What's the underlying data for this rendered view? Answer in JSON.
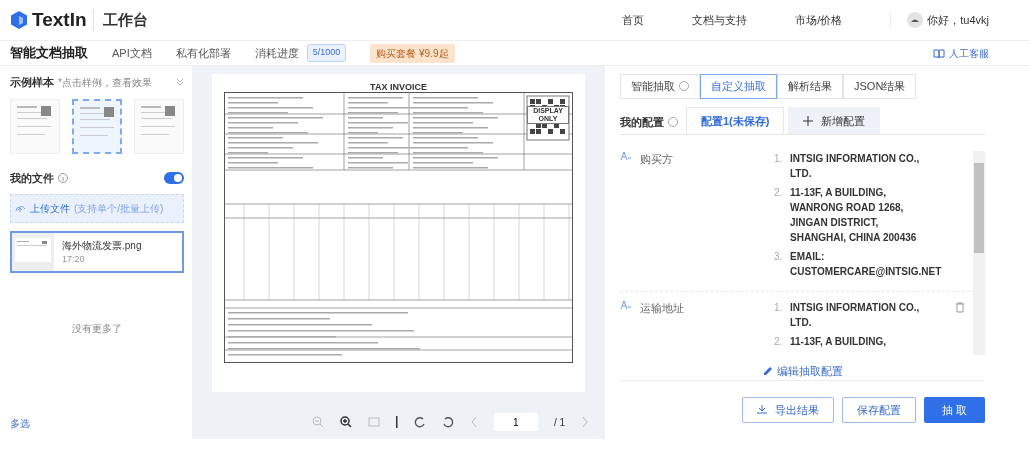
{
  "header": {
    "logo": "TextIn",
    "workspace": "工作台",
    "nav": [
      "首页",
      "文档与支持",
      "市场/价格"
    ],
    "user": "你好，tu4vkj"
  },
  "subnav": {
    "items": [
      {
        "label": "智能文档抽取",
        "selected": true
      },
      {
        "label": "API文档",
        "selected": false
      },
      {
        "label": "私有化部署",
        "selected": false
      }
    ],
    "usage_label": "消耗进度",
    "usage": "5/1000",
    "promo": "购买套餐 ¥9.9起",
    "support": "人工客服"
  },
  "samples": {
    "title": "示例样本",
    "hint": "*点击样例，查看效果",
    "thumbs": [
      {
        "selected": false
      },
      {
        "selected": true
      },
      {
        "selected": false
      }
    ]
  },
  "files": {
    "title": "我的文件",
    "toggle_on": true,
    "upload": "上传文件",
    "upload_hint": "(支持单个/批量上传)",
    "items": [
      {
        "name": "海外物流发票.png",
        "time": "17:20",
        "selected": true
      }
    ],
    "end": "没有更多了",
    "multi": "多选"
  },
  "document": {
    "title": "TAX INVOICE",
    "stamp": "DISPLAY ONLY"
  },
  "viewer_toolbar": {
    "page": "1",
    "total": "/ 1"
  },
  "result_tabs": [
    {
      "label": "智能抽取",
      "selected": false,
      "help": true
    },
    {
      "label": "自定义抽取",
      "selected": true,
      "help": false
    },
    {
      "label": "解析结果",
      "selected": false,
      "help": false
    },
    {
      "label": "JSON结果",
      "selected": false,
      "help": false
    }
  ],
  "config": {
    "label": "我的配置",
    "tabs": [
      {
        "label": "配置1(未保存)",
        "selected": true,
        "kind": "config"
      },
      {
        "label": "新增配置",
        "selected": false,
        "kind": "add"
      }
    ]
  },
  "fields": [
    {
      "name": "购买方",
      "deletable": false,
      "values": [
        {
          "num": "1.",
          "text": "INTSIG INFORMATION CO., LTD."
        },
        {
          "num": "2.",
          "text": "11-13F, A BUILDING, WANRONG ROAD 1268, JINGAN DISTRICT, SHANGHAI, CHINA 200436"
        },
        {
          "num": "3.",
          "text": "EMAIL: CUSTOMERCARE@INTSIG.NET"
        }
      ]
    },
    {
      "name": "运输地址",
      "deletable": true,
      "values": [
        {
          "num": "1.",
          "text": "INTSIG INFORMATION CO., LTD."
        },
        {
          "num": "2.",
          "text": "11-13F, A BUILDING,"
        }
      ]
    }
  ],
  "edit_link": "编辑抽取配置",
  "buttons": [
    {
      "label": "导出结果",
      "kind": "export"
    },
    {
      "label": "保存配置",
      "kind": "outline"
    },
    {
      "label": "抽 取",
      "kind": "primary"
    }
  ]
}
